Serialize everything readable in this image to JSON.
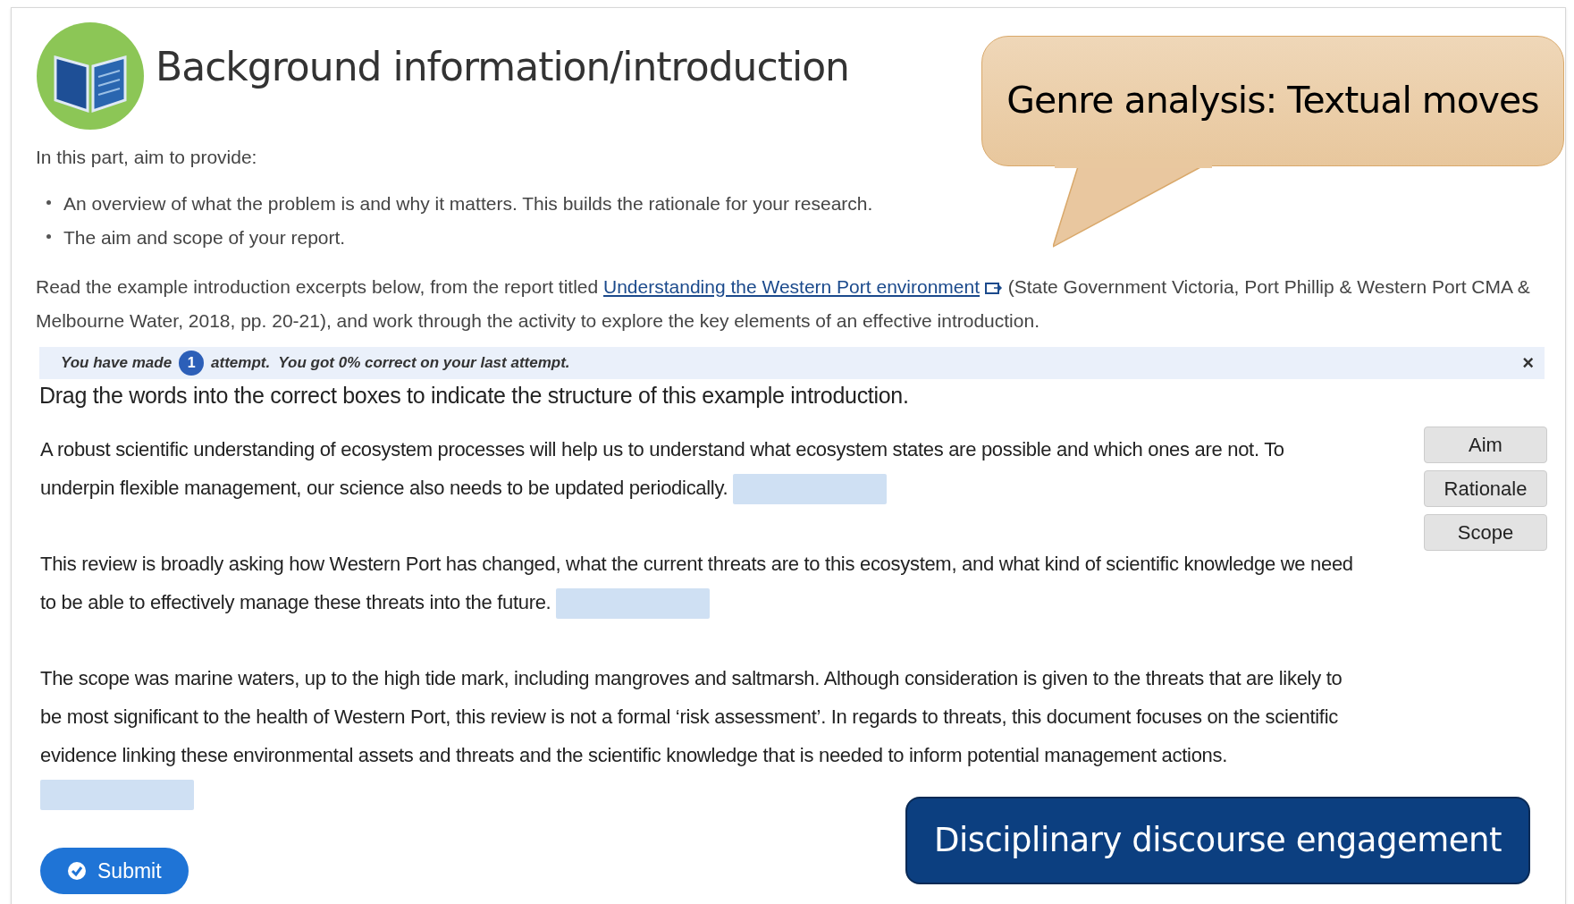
{
  "header": {
    "title": "Background information/introduction"
  },
  "intro": "In this part, aim to provide:",
  "bullets": [
    "An overview of what the problem is and why it matters. This builds the rationale for your research.",
    "The aim and scope of your report."
  ],
  "reading": {
    "before": "Read the example introduction excerpts below, from the report titled",
    "link": "Understanding the Western Port environment",
    "after": "(State Government Victoria, Port Phillip & Western Port CMA & Melbourne Water, 2018, pp. 20-21), and work through the activity to explore the key elements of an effective introduction."
  },
  "feedback": {
    "before": "You have made",
    "count": "1",
    "after": "attempt.  You got 0% correct on your last attempt.",
    "close": "×"
  },
  "instruction": "Drag the words into the correct boxes to indicate the structure of this example introduction.",
  "paragraphs": [
    "A robust scientific understanding of ecosystem processes will help us to understand what ecosystem states are possible and which ones are not. To underpin flexible management, our science also needs to be updated periodically.",
    "This review is broadly asking how Western Port has changed, what the current threats are to this ecosystem, and what kind of scientific knowledge we need to be able to effectively manage these threats into the future.",
    "The scope was marine waters, up to the high tide mark, including mangroves and saltmarsh. Although consideration is given to the threats that are likely to be most significant to the health of Western Port, this review is not a formal ‘risk assessment’. In regards to threats, this document focuses on the scientific evidence linking these environmental assets and threats and the scientific knowledge that is needed to inform potential management actions."
  ],
  "word_bank": [
    "Aim",
    "Rationale",
    "Scope"
  ],
  "submit": "Submit",
  "callouts": [
    {
      "kind": "speech",
      "text": "Genre analysis: Textual moves"
    },
    {
      "kind": "box",
      "text": "Disciplinary discourse engagement"
    }
  ]
}
